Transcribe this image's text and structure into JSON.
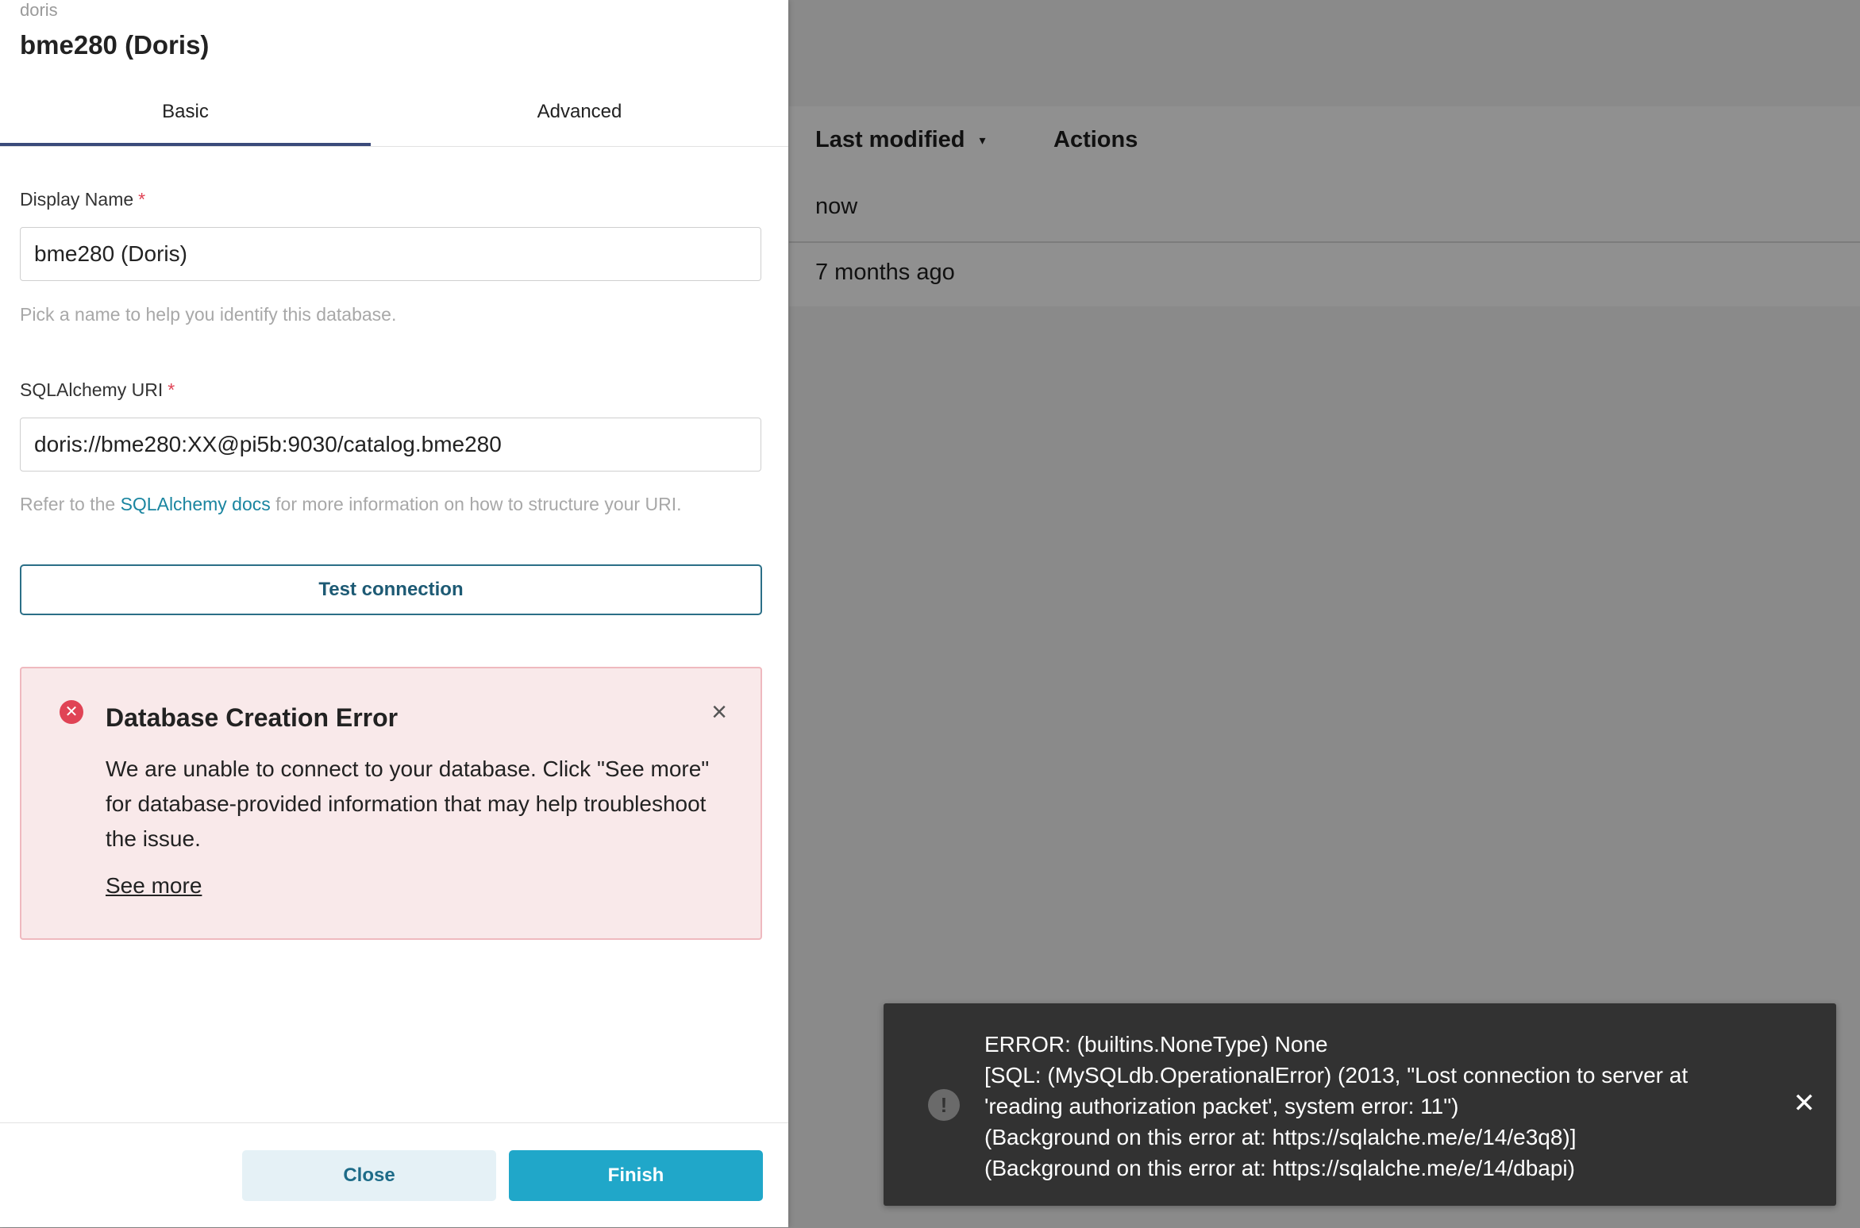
{
  "background": {
    "columns": {
      "last_modified": "Last modified",
      "actions": "Actions"
    },
    "sort_icon": "sort-descending-icon",
    "rows": [
      "now",
      "7 months ago"
    ]
  },
  "modal": {
    "engine": "doris",
    "title": "bme280 (Doris)",
    "tabs": {
      "basic": "Basic",
      "advanced": "Advanced"
    },
    "display_name": {
      "label": "Display Name",
      "required": "*",
      "value": "bme280 (Doris)",
      "helper": "Pick a name to help you identify this database."
    },
    "uri": {
      "label": "SQLAlchemy URI",
      "required": "*",
      "value": "doris://bme280:XX@pi5b:9030/catalog.bme280",
      "helper_prefix": "Refer to the ",
      "helper_link": "SQLAlchemy docs",
      "helper_suffix": " for more information on how to structure your URI."
    },
    "test_connection": "Test connection",
    "alert": {
      "icon": "error-circle-icon",
      "title": "Database Creation Error",
      "message": "We are unable to connect to your database. Click \"See more\" for database-provided information that may help troubleshoot the issue.",
      "see_more": "See more",
      "close_glyph": "×"
    },
    "footer": {
      "close": "Close",
      "finish": "Finish"
    }
  },
  "toast": {
    "icon": "warning-icon",
    "lines": [
      "ERROR: (builtins.NoneType) None",
      "[SQL: (MySQLdb.OperationalError) (2013, \"Lost connection to server at",
      "'reading authorization packet', system error: 11\")",
      "(Background on this error at: https://sqlalche.me/e/14/e3q8)]",
      "(Background on this error at: https://sqlalche.me/e/14/dbapi)"
    ],
    "close_glyph": "✕"
  },
  "colors": {
    "overlay": "#8a8a8a",
    "error": "#e04355",
    "primary": "#20a7c9",
    "link": "#1a85a0",
    "toast_bg": "#323232"
  }
}
